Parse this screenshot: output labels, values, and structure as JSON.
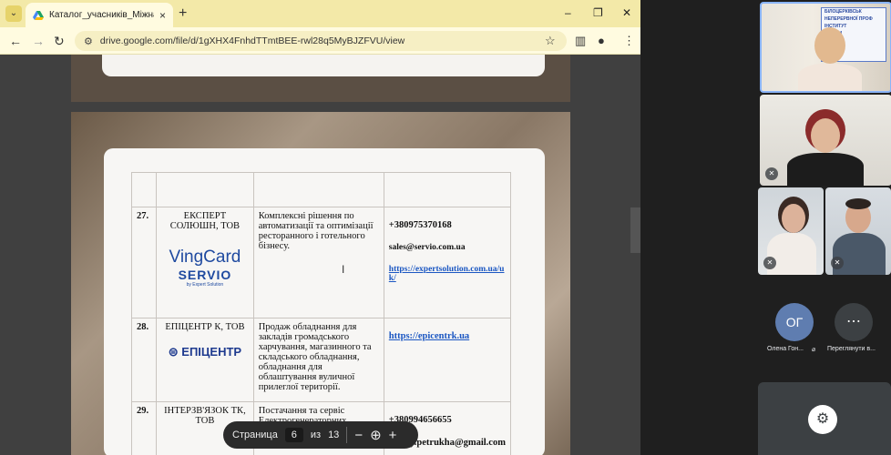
{
  "browser": {
    "tab_title": "Каталог_учасників_Міжнарод",
    "url": "drive.google.com/file/d/1gXHX4FnhdTTmtBEE-rwl28q5MyBJZFVU/view",
    "tab_close_glyph": "×",
    "new_tab_glyph": "+",
    "win_minimize": "–",
    "win_maximize": "❐",
    "win_close": "✕"
  },
  "toolbar": {
    "back_glyph": "←",
    "forward_glyph": "→",
    "reload_glyph": "↻",
    "bookmark_glyph": "☆",
    "menu_glyph": "⋮"
  },
  "catalog": {
    "rows": [
      {
        "num": "27.",
        "company": "ЕКСПЕРТ СОЛЮШН, ТОВ",
        "logo_main": "VingCard",
        "logo_second": "SERVIO",
        "logo_sub": "by Expert Solution",
        "description": "Комплексні рішення по автоматизації та оптимізації ресторанного і готельного бізнесу.",
        "phone": "+380975370168",
        "email": "sales@servio.com.ua",
        "link": "https://expertsolution.com.ua/uk/"
      },
      {
        "num": "28.",
        "company": "ЕПІЦЕНТР К, ТОВ",
        "logo_main": "ЕПІЦЕНТР",
        "description": "Продаж обладнання для закладів громадського харчування, магазинного та складського обладнання, обладнання для облаштування вуличної прилеглої території.",
        "link": "https://epicentrk.ua"
      },
      {
        "num": "29.",
        "company": "ІНТЕРЗВ'ЯЗОК ТК, ТОВ",
        "description": "Постачання та сервіс Електрогенераторних",
        "phone": "+380994656655",
        "email": "sergey.petrukha@gmail.com"
      }
    ]
  },
  "pagebar": {
    "label": "Страница",
    "page": "6",
    "of_label": "из",
    "total": "13",
    "zoom_out": "−",
    "zoom_icon": "⊕",
    "zoom_in": "+"
  },
  "meet": {
    "participants": [
      {
        "initials": "ОГ",
        "name": "Олена Гон..."
      },
      {
        "name": "Переглянути в..."
      }
    ],
    "more_glyph": "⋯",
    "banner_lines": [
      "БІЛОЦЕРКІВСЬК",
      "НЕПЕРЕРВНОЇ ПРОФ",
      "ІНСТИТУТ",
      "ОСВІТИ"
    ]
  },
  "colors": {
    "tab_strip": "#f3e9a8",
    "link_blue": "#1a56c2",
    "meet_bg": "#1f1f1f"
  }
}
